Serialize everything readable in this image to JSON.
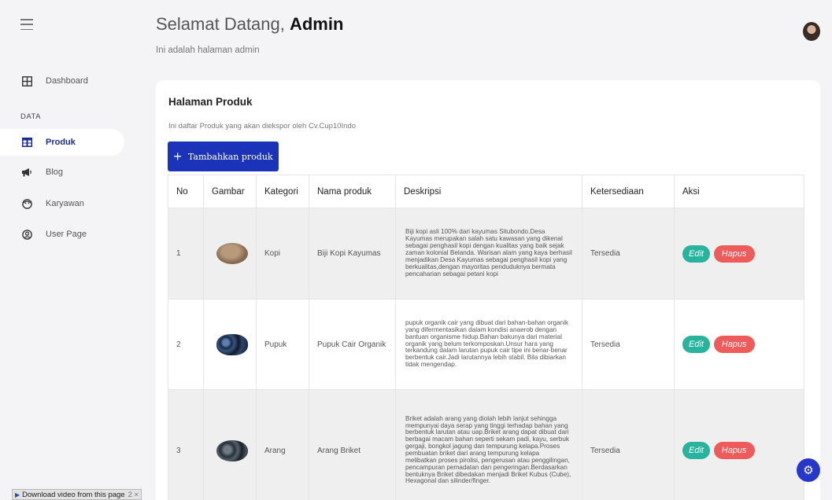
{
  "sidebar": {
    "section_label": "DATA",
    "items": [
      {
        "label": "Dashboard",
        "icon": "grid-icon"
      },
      {
        "label": "Produk",
        "icon": "table-icon"
      },
      {
        "label": "Blog",
        "icon": "megaphone-icon"
      },
      {
        "label": "Karyawan",
        "icon": "face-icon"
      },
      {
        "label": "User Page",
        "icon": "user-circle-icon"
      }
    ]
  },
  "header": {
    "greeting": "Selamat Datang, ",
    "user": "Admin",
    "subtitle": "Ini adalah halaman admin"
  },
  "card": {
    "title": "Halaman Produk",
    "subtitle": "Ini daftar Produk yang akan diekspor oleh Cv.Cup10Indo",
    "add_button": "Tambahkan produk"
  },
  "table": {
    "headers": [
      "No",
      "Gambar",
      "Kategori",
      "Nama produk",
      "Deskripsi",
      "Ketersediaan",
      "Aksi"
    ],
    "rows": [
      {
        "no": "1",
        "kategori": "Kopi",
        "nama": "Biji Kopi Kayumas",
        "deskripsi": "Biji kopi asli 100% dari kayumas Situbondo.Desa Kayumas merupakan salah satu kawasan yang dikenal sebagai penghasil kopi dengan kualitas yang baik sejak zaman kolonial Belanda. Warisan alam yang kaya berhasil menjadikan Desa Kayumas sebagai penghasil kopi yang berkualitas,dengan mayoritas penduduknya bermata pencaharian sebagai petani kopi",
        "ketersediaan": "Tersedia"
      },
      {
        "no": "2",
        "kategori": "Pupuk",
        "nama": "Pupuk Cair Organik",
        "deskripsi": "pupuk organik cair yang dibuat dari bahan-bahan organik yang difermentasikan dalam kondisi anaerob dengan bantuan organisme hidup.Bahan bakunya dari material organik yang belum terkomposkan.Unsur hara yang terkandung dalam larutan pupuk cair tipe ini benar-benar berbentuk cair.Jadi larutannya lebih stabil. Bila dibiarkan tidak mengendap.",
        "ketersediaan": "Tersedia"
      },
      {
        "no": "3",
        "kategori": "Arang",
        "nama": "Arang Briket",
        "deskripsi": "Briket adalah arang yang diolah lebih lanjut sehingga mempunyai daya serap yang tinggi terhadap bahan yang berbentuk larutan atau uap.Briket arang dapat dibuat dari berbagai macam bahan seperti sekam padi, kayu, serbuk gergaji, bongkol jagung dan tempurung kelapa.Proses pembuatan briket dari arang tempurung kelapa melibatkan proses pirolisi, pengerusan atau penggilingan, pencampuran pemadatan dan pengeringan.Berdasarkan bentuknya Briket dibedakan menjadi Briket Kubus (Cube), Hexagonal dan silinder/finger.",
        "ketersediaan": "Tersedia"
      }
    ],
    "edit_label": "Edit",
    "delete_label": "Hapus"
  },
  "download_bar": {
    "label": "Download video from this page",
    "suffix": "2 ×"
  }
}
